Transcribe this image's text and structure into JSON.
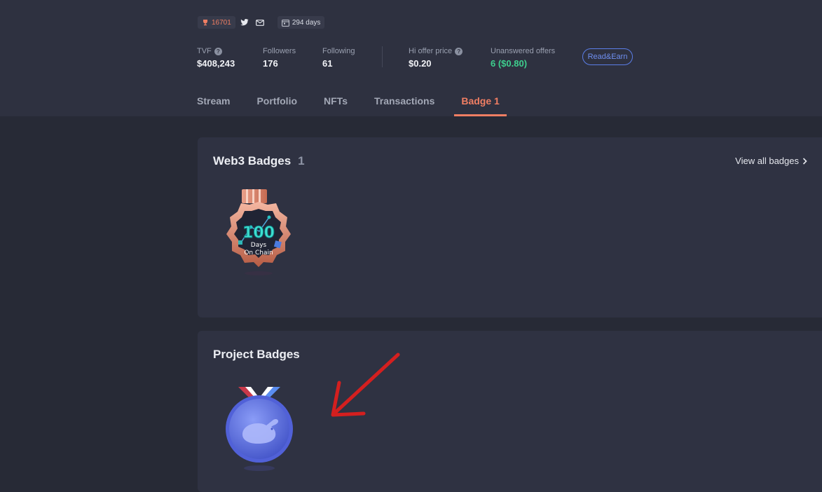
{
  "profile": {
    "rank": "16701",
    "days": "294 days"
  },
  "stats": [
    {
      "label": "TVF",
      "value": "$408,243",
      "help": true
    },
    {
      "label": "Followers",
      "value": "176",
      "help": false
    },
    {
      "label": "Following",
      "value": "61",
      "help": false
    },
    {
      "label": "Hi offer price",
      "value": "$0.20",
      "help": true
    },
    {
      "label": "Unanswered offers",
      "value": "6 ($0.80)",
      "help": false,
      "accent": "#3ecf8e"
    }
  ],
  "read_earn_label": "Read&Earn",
  "tabs": [
    {
      "label": "Stream",
      "active": false
    },
    {
      "label": "Portfolio",
      "active": false
    },
    {
      "label": "NFTs",
      "active": false
    },
    {
      "label": "Transactions",
      "active": false
    },
    {
      "label": "Badge 1",
      "active": true
    }
  ],
  "web3_badges": {
    "title": "Web3 Badges",
    "count": "1",
    "view_all": "View all badges",
    "badge": {
      "number": "100",
      "line1": "Days",
      "line2": "On Chain"
    }
  },
  "project_badges": {
    "title": "Project Badges"
  },
  "colors": {
    "accent": "#f07e63",
    "positive": "#3ecf8e",
    "link": "#6f8ff0",
    "annotation_arrow": "#d41f1f"
  },
  "icons": [
    "trophy-icon",
    "twitter-icon",
    "mail-icon",
    "calendar-icon",
    "help-icon",
    "chevron-right-icon",
    "rabbit-icon"
  ]
}
